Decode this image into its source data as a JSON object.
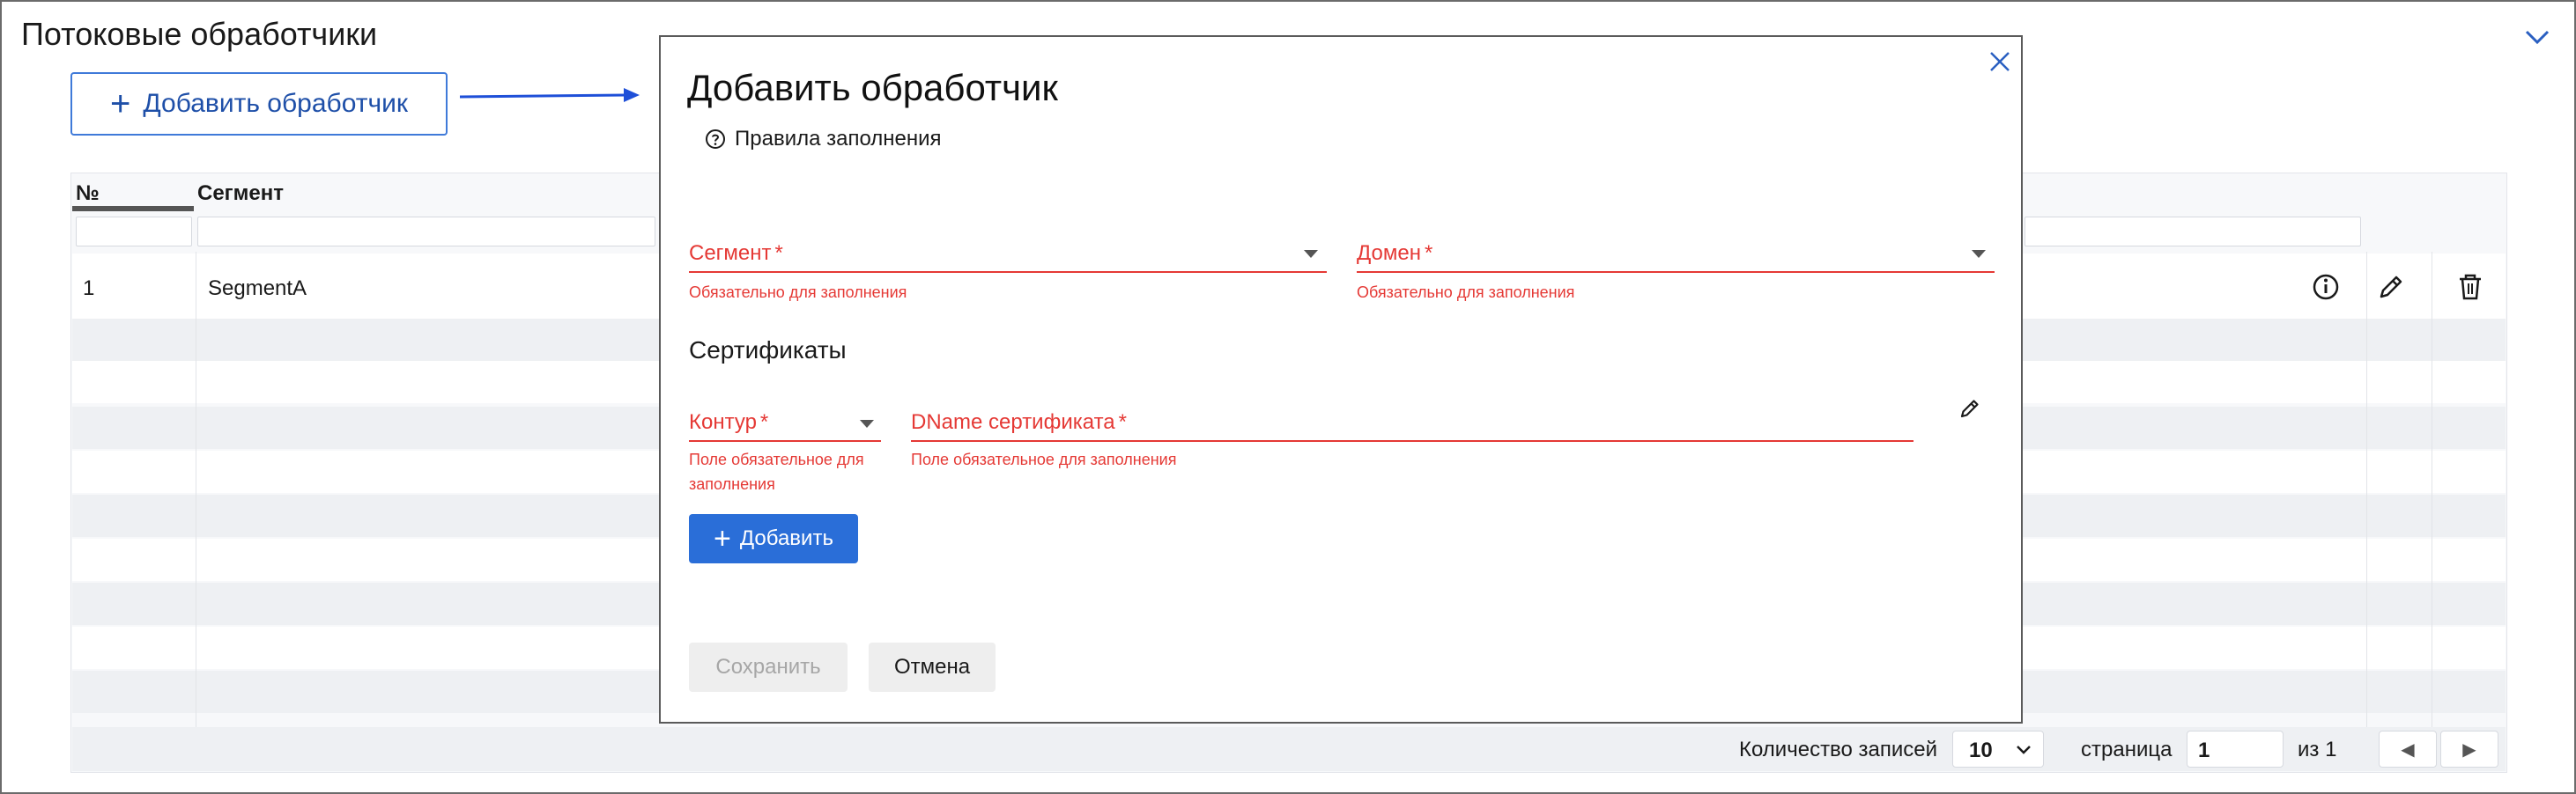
{
  "page": {
    "title": "Потоковые обработчики",
    "add_button_label": "Добавить обработчик"
  },
  "table": {
    "columns": [
      "№",
      "Сегмент"
    ],
    "rows": [
      {
        "num": "1",
        "segment": "SegmentA"
      }
    ],
    "row_icons": [
      "info-icon",
      "pencil-icon",
      "trash-icon"
    ]
  },
  "footer": {
    "records_label": "Количество записей",
    "records_value": "10",
    "page_label": "страница",
    "page_value": "1",
    "of_label": "из 1",
    "prev_glyph": "◀",
    "next_glyph": "▶"
  },
  "modal": {
    "title": "Добавить обработчик",
    "rules_link": "Правила заполнения",
    "segment": {
      "label": "Сегмент",
      "required_mark": "*",
      "error": "Обязательно для заполнения"
    },
    "domain": {
      "label": "Домен",
      "required_mark": "*",
      "error": "Обязательно для заполнения"
    },
    "certificates_title": "Сертификаты",
    "contour": {
      "label": "Контур",
      "required_mark": "*",
      "error": "Поле обязательное для заполнения"
    },
    "dname": {
      "label": "DName сертификата",
      "required_mark": "*",
      "error": "Поле обязательное для заполнения"
    },
    "add_button": "Добавить",
    "save_button": "Сохранить",
    "cancel_button": "Отмена"
  },
  "colors": {
    "accent": "#2a6ed8",
    "error": "#e53935",
    "outline_button": "#3f7ad9"
  }
}
